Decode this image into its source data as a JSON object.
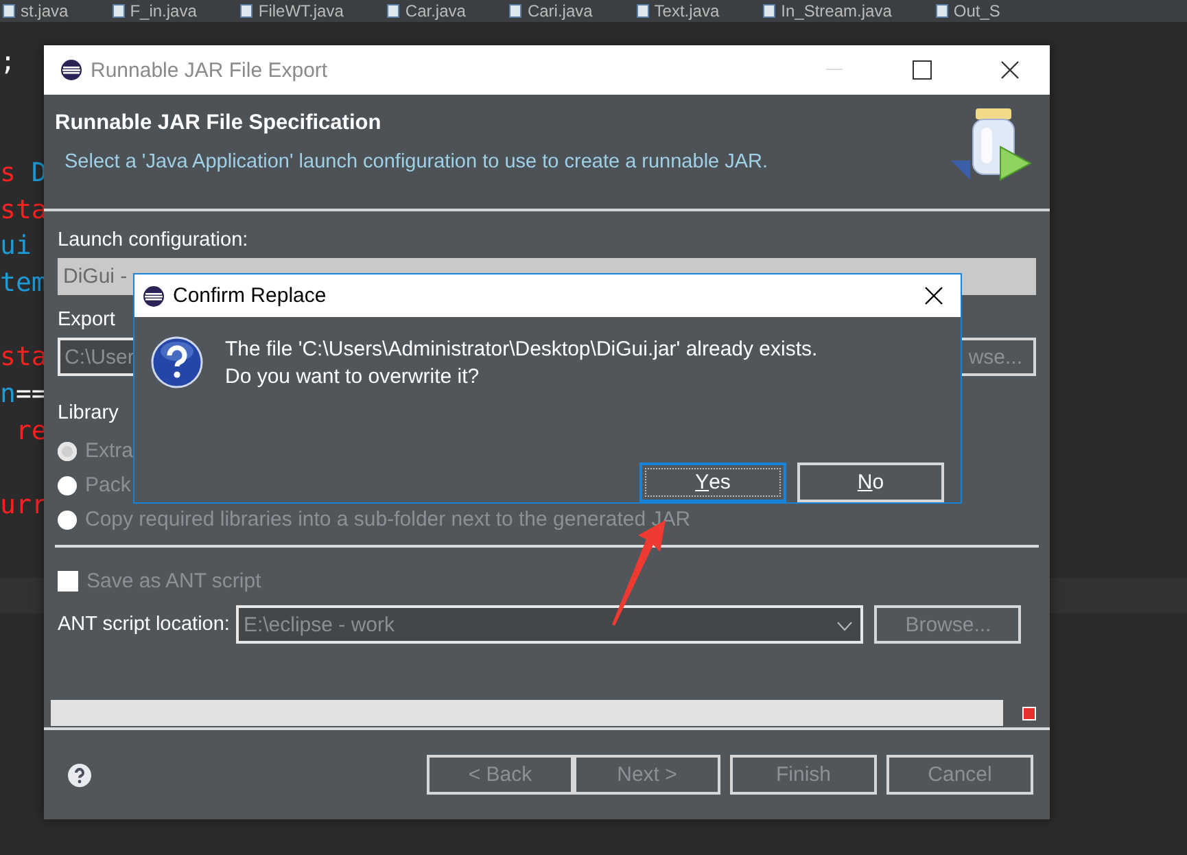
{
  "editor": {
    "tabs": [
      {
        "label": "st.java",
        "selected": false
      },
      {
        "label": "F_in.java",
        "selected": false
      },
      {
        "label": "FileWT.java",
        "selected": false
      },
      {
        "label": "Car.java",
        "selected": false
      },
      {
        "label": "Cari.java",
        "selected": false
      },
      {
        "label": "Text.java",
        "selected": false
      },
      {
        "label": "In_Stream.java",
        "selected": false
      },
      {
        "label": "Out_S",
        "selected": false
      }
    ],
    "code_lines": [
      {
        "kind": "code",
        "segments": [
          {
            "text": ";",
            "color": "#ffffff"
          }
        ]
      },
      {
        "kind": "blank"
      },
      {
        "kind": "blank"
      },
      {
        "kind": "code",
        "segments": [
          {
            "text": "s",
            "color": "#ff2020"
          },
          {
            "text": " D",
            "color": "#1e9ad6"
          }
        ]
      },
      {
        "kind": "code",
        "segments": [
          {
            "text": "sta",
            "color": "#ff2020"
          }
        ]
      },
      {
        "kind": "code",
        "segments": [
          {
            "text": "ui",
            "color": "#1e9ad6"
          }
        ]
      },
      {
        "kind": "code",
        "segments": [
          {
            "text": "tem",
            "color": "#1e9ad6"
          }
        ]
      },
      {
        "kind": "blank"
      },
      {
        "kind": "code",
        "segments": [
          {
            "text": "sta",
            "color": "#ff2020"
          }
        ]
      },
      {
        "kind": "code",
        "segments": [
          {
            "text": "n",
            "color": "#1e9ad6"
          },
          {
            "text": "==",
            "color": "#ffffff"
          }
        ]
      },
      {
        "kind": "code",
        "segments": [
          {
            "text": " re",
            "color": "#ff2020"
          }
        ]
      },
      {
        "kind": "blank"
      },
      {
        "kind": "code",
        "segments": [
          {
            "text": "urr",
            "color": "#ff2020"
          }
        ]
      }
    ]
  },
  "wizard": {
    "title": "Runnable JAR File Export",
    "heading": "Runnable JAR File Specification",
    "description": "Select a 'Java Application' launch configuration to use to create a runnable JAR.",
    "launch_label": "Launch configuration:",
    "launch_value": "DiGui -",
    "export_label": "Export",
    "export_value": "C:\\User",
    "export_browse": "wse...",
    "library_label": "Library",
    "library_options": [
      {
        "label": "Extra",
        "selected": true
      },
      {
        "label": "Pack",
        "selected": false
      },
      {
        "label": "Copy required libraries into a sub-folder next to the generated JAR",
        "selected": false
      }
    ],
    "save_ant": {
      "label": "Save as ANT script",
      "checked": false
    },
    "ant_label": "ANT script location:",
    "ant_value": "E:\\eclipse - work",
    "ant_browse": "Browse...",
    "progress": {
      "level": 0
    },
    "buttons": [
      {
        "label": "< Back",
        "disabled": true
      },
      {
        "label": "Next >",
        "disabled": true
      },
      {
        "label": "Finish",
        "disabled": true
      },
      {
        "label": "Cancel",
        "disabled": true
      }
    ]
  },
  "confirm": {
    "title": "Confirm Replace",
    "message": [
      "The file 'C:\\Users\\Administrator\\Desktop\\DiGui.jar' already exists.",
      "Do you want to overwrite it?"
    ],
    "buttons": [
      {
        "label": "Yes",
        "default": true,
        "mnemonic_underlined": true
      },
      {
        "label": "No",
        "default": false,
        "mnemonic_underlined": true
      }
    ]
  }
}
